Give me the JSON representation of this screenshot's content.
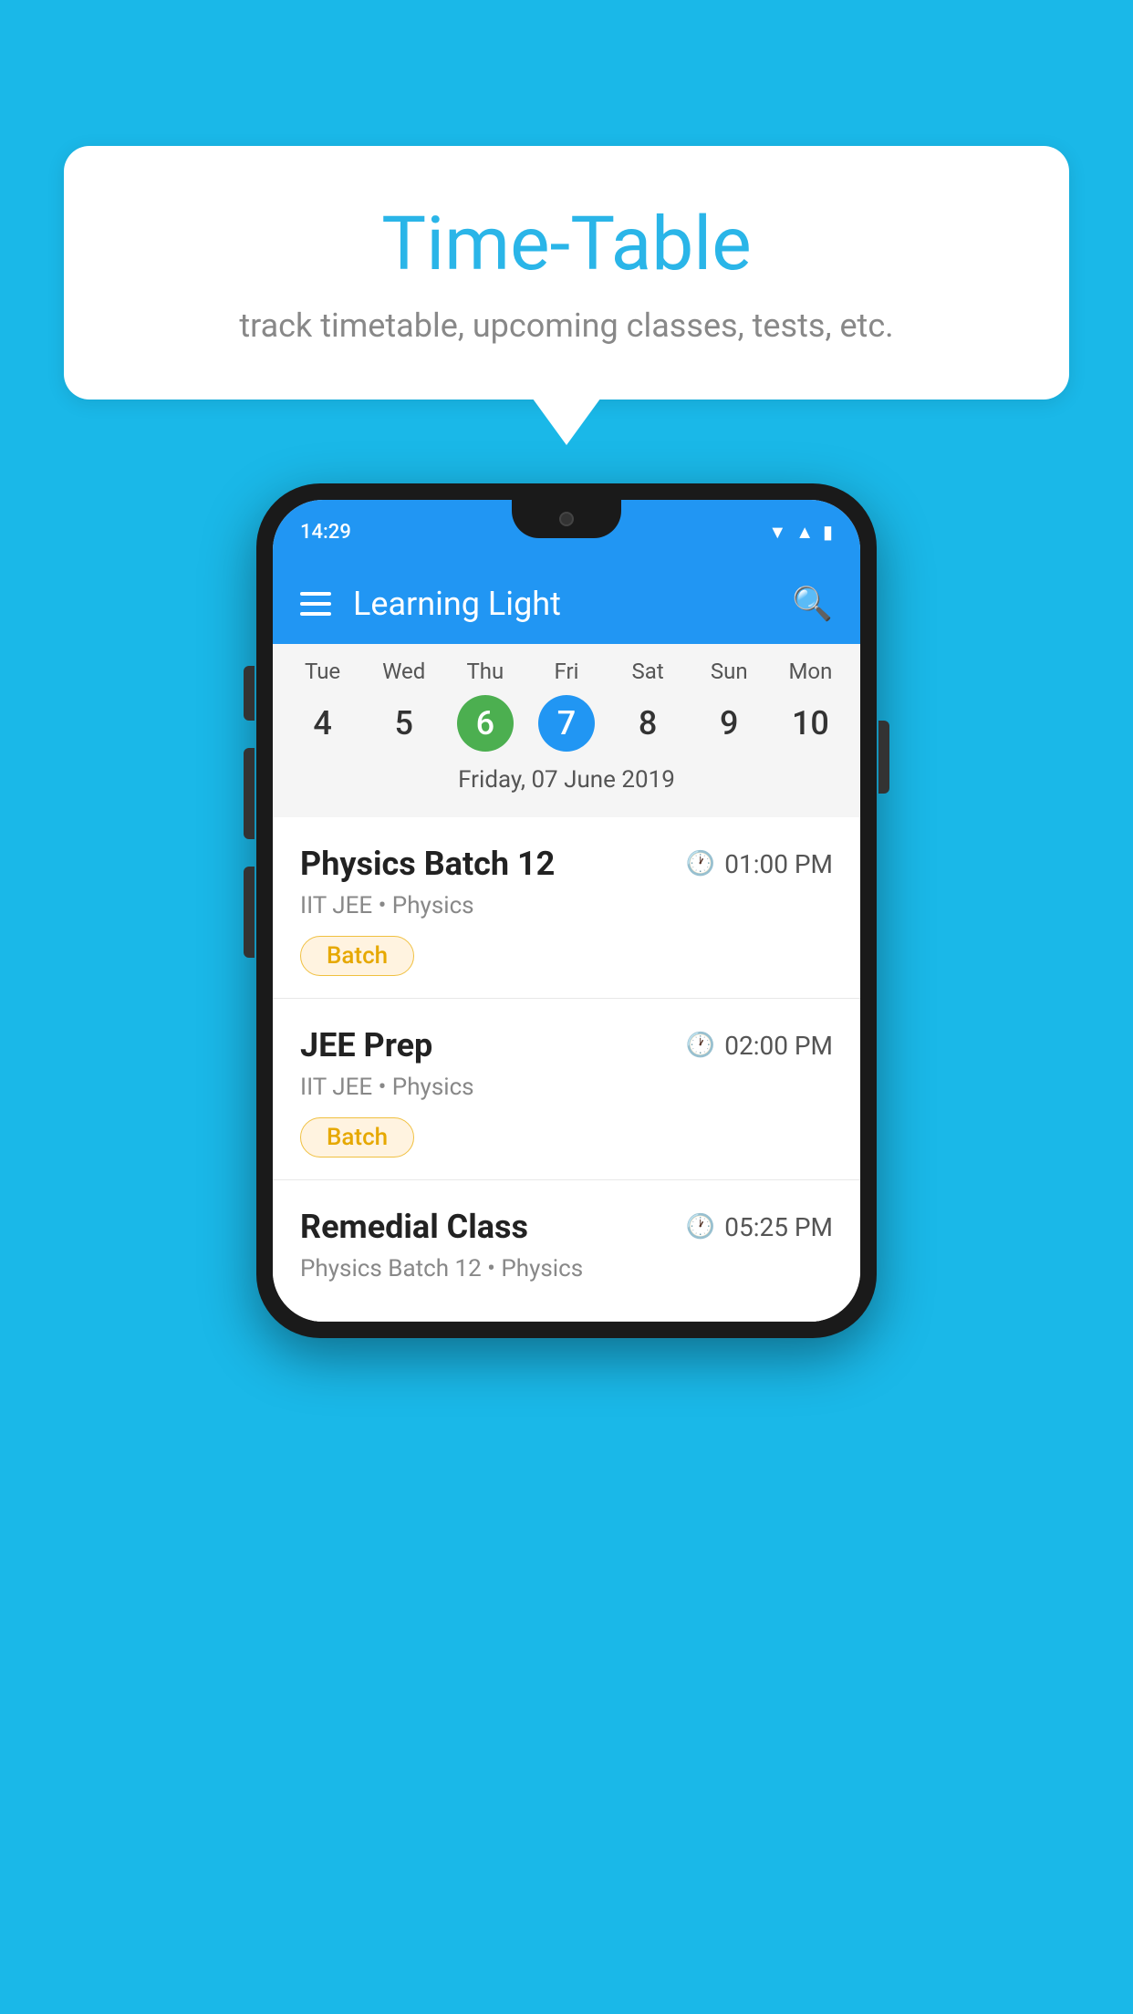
{
  "background": {
    "color": "#1ab8e8"
  },
  "bubble": {
    "title": "Time-Table",
    "subtitle": "track timetable, upcoming classes, tests, etc."
  },
  "phone": {
    "status_bar": {
      "time": "14:29"
    },
    "app_bar": {
      "title": "Learning Light"
    },
    "calendar": {
      "days": [
        "Tue",
        "Wed",
        "Thu",
        "Fri",
        "Sat",
        "Sun",
        "Mon"
      ],
      "dates": [
        "4",
        "5",
        "6",
        "7",
        "8",
        "9",
        "10"
      ],
      "today_index": 2,
      "selected_index": 3,
      "selected_date_label": "Friday, 07 June 2019"
    },
    "schedule": [
      {
        "title": "Physics Batch 12",
        "time": "01:00 PM",
        "subtitle": "IIT JEE • Physics",
        "badge": "Batch"
      },
      {
        "title": "JEE Prep",
        "time": "02:00 PM",
        "subtitle": "IIT JEE • Physics",
        "badge": "Batch"
      },
      {
        "title": "Remedial Class",
        "time": "05:25 PM",
        "subtitle": "Physics Batch 12 • Physics",
        "badge": null
      }
    ]
  }
}
